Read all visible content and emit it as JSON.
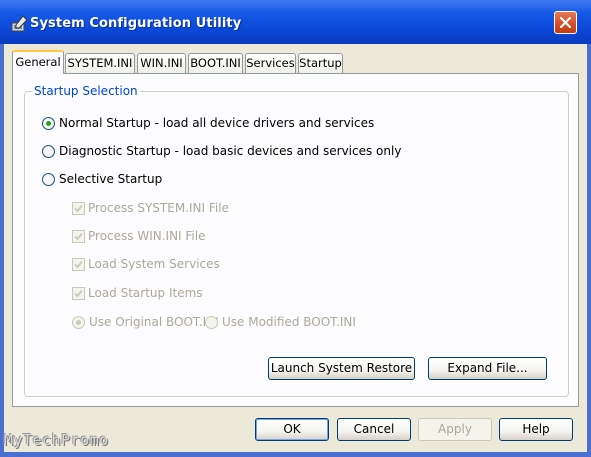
{
  "window": {
    "title": "System Configuration Utility",
    "icon": "system-config-icon",
    "close_icon": "close-icon"
  },
  "tabs": [
    {
      "label": "General",
      "active": true
    },
    {
      "label": "SYSTEM.INI",
      "active": false
    },
    {
      "label": "WIN.INI",
      "active": false
    },
    {
      "label": "BOOT.INI",
      "active": false
    },
    {
      "label": "Services",
      "active": false
    },
    {
      "label": "Startup",
      "active": false
    }
  ],
  "startup_selection": {
    "legend": "Startup Selection",
    "options": [
      {
        "label": "Normal Startup - load all device drivers and services",
        "selected": true
      },
      {
        "label": "Diagnostic Startup - load basic devices and services only",
        "selected": false
      },
      {
        "label": "Selective Startup",
        "selected": false
      }
    ],
    "selective_items": [
      {
        "label": "Process SYSTEM.INI File",
        "checked": true,
        "enabled": false
      },
      {
        "label": "Process WIN.INI File",
        "checked": true,
        "enabled": false
      },
      {
        "label": "Load System Services",
        "checked": true,
        "enabled": false
      },
      {
        "label": "Load Startup Items",
        "checked": true,
        "enabled": false
      }
    ],
    "boot_options": [
      {
        "label": "Use Original BOOT.INI",
        "selected": true,
        "enabled": false
      },
      {
        "label": "Use Modified BOOT.INI",
        "selected": false,
        "enabled": false
      }
    ]
  },
  "panel_buttons": {
    "launch_restore": "Launch System Restore",
    "expand_file": "Expand File..."
  },
  "dialog_buttons": {
    "ok": "OK",
    "cancel": "Cancel",
    "apply": "Apply",
    "help": "Help"
  },
  "watermark": "MyTechPromo",
  "colors": {
    "titlebar": "#0b47d6",
    "accent_legend": "#0046d5",
    "active_tab_highlight": "#ffc83c",
    "dialog_background": "#ece9d8"
  }
}
